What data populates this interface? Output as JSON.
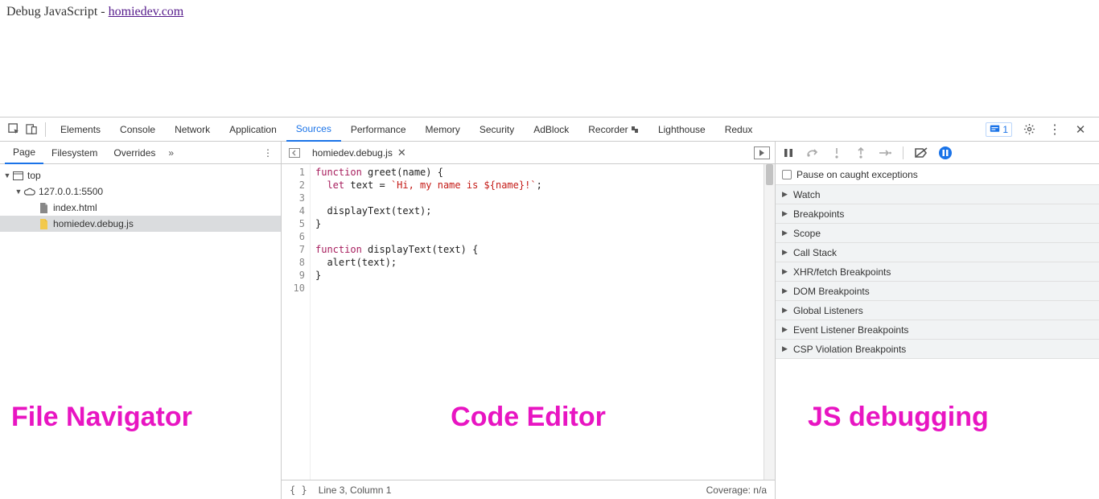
{
  "page": {
    "title_prefix": "Debug JavaScript - ",
    "link_text": "homiedev.com"
  },
  "devtools": {
    "tabs": [
      "Elements",
      "Console",
      "Network",
      "Application",
      "Sources",
      "Performance",
      "Memory",
      "Security",
      "AdBlock",
      "Recorder",
      "Lighthouse",
      "Redux"
    ],
    "active_tab": "Sources",
    "issue_count": "1"
  },
  "navigator": {
    "tabs": [
      "Page",
      "Filesystem",
      "Overrides"
    ],
    "active_tab": "Page",
    "tree": {
      "top_label": "top",
      "host_label": "127.0.0.1:5500",
      "files": [
        "index.html",
        "homiedev.debug.js"
      ],
      "selected_file": "homiedev.debug.js"
    }
  },
  "editor": {
    "open_file": "homiedev.debug.js",
    "lines": [
      "function greet(name) {",
      "  let text = `Hi, my name is ${name}!`;",
      "",
      "  displayText(text);",
      "}",
      "",
      "function displayText(text) {",
      "  alert(text);",
      "}",
      ""
    ],
    "cursor_status": "Line 3, Column 1",
    "coverage_status": "Coverage: n/a"
  },
  "debugger": {
    "pause_label": "Pause on caught exceptions",
    "sections": [
      "Watch",
      "Breakpoints",
      "Scope",
      "Call Stack",
      "XHR/fetch Breakpoints",
      "DOM Breakpoints",
      "Global Listeners",
      "Event Listener Breakpoints",
      "CSP Violation Breakpoints"
    ]
  },
  "annotations": {
    "left": "File Navigator",
    "mid": "Code Editor",
    "right": "JS debugging"
  }
}
